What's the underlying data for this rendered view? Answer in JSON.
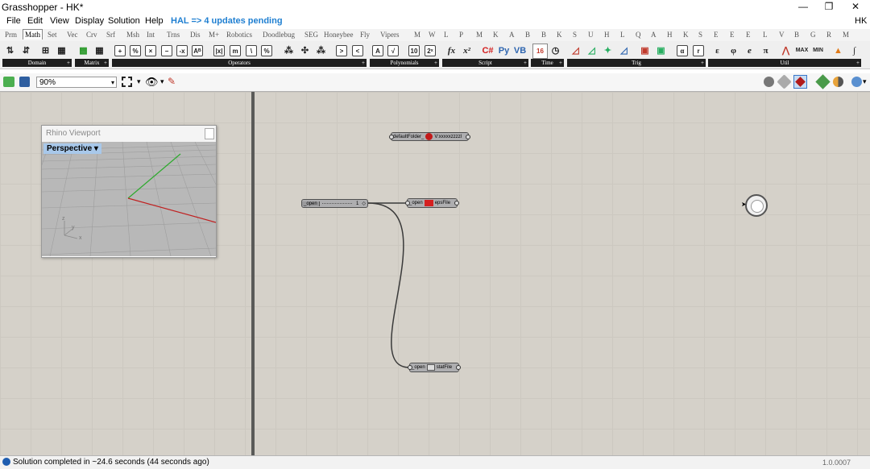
{
  "window": {
    "title": "Grasshopper - HK*",
    "minimize": "—",
    "restore": "❐",
    "close": "✕"
  },
  "menu": {
    "items": [
      "File",
      "Edit",
      "View",
      "Display",
      "Solution",
      "Help"
    ],
    "notice": "HAL => 4 updates pending",
    "right": "HK"
  },
  "tabs": [
    "Prm",
    "Math",
    "Set",
    "Vec",
    "Crv",
    "Srf",
    "Msh",
    "Int",
    "Trns",
    "Dis",
    "M+",
    "Robotics",
    "Doodlebug",
    "SEG",
    "Honeybee",
    "Fly",
    "Vipers",
    "M",
    "W",
    "L",
    "P",
    "M",
    "K",
    "A",
    "B",
    "B",
    "K",
    "S",
    "U",
    "H",
    "L",
    "Q",
    "A",
    "H",
    "K",
    "S",
    "E",
    "E",
    "E",
    "L",
    "V",
    "B",
    "G",
    "R",
    "M"
  ],
  "active_tab": "Math",
  "groups": [
    "Domain",
    "Matrix",
    "Operators",
    "Polynomials",
    "Script",
    "Time",
    "Trig",
    "Util"
  ],
  "zoom": "90%",
  "rhino_viewport": {
    "title": "Rhino Viewport",
    "view": "Perspective",
    "axis_y": "y",
    "axis_x": "x",
    "axis_z": "z"
  },
  "components": {
    "default_folder": {
      "label": "defaultFolder_",
      "output": "V:xxxxxzzzzl"
    },
    "slider": {
      "label": "_open",
      "value": "1"
    },
    "eps": {
      "input": "_open",
      "output": "epsFile"
    },
    "stat": {
      "input": "_open",
      "output": "statFile"
    }
  },
  "status": {
    "text": "Solution completed in ~24.6 seconds (44 seconds ago)",
    "version": "1.0.0007"
  },
  "colors": {
    "canvas": "#d5d1c9",
    "hal": "#1f7fd1",
    "wire": "#3a3a3a"
  }
}
